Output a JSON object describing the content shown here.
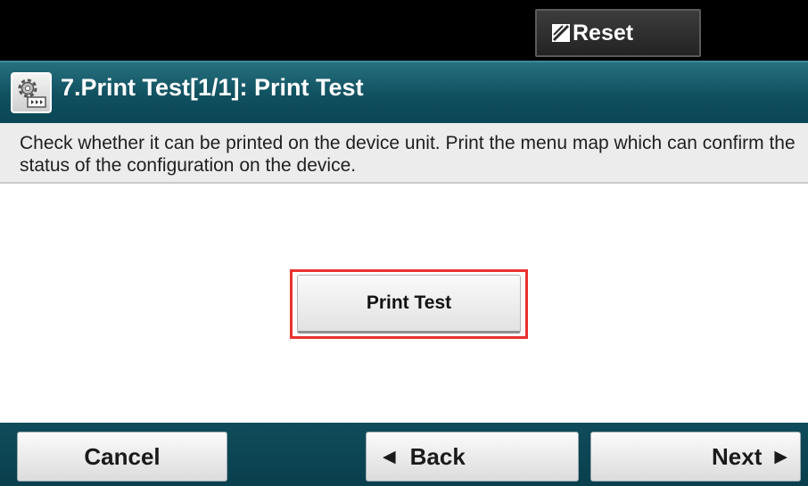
{
  "topbar": {
    "reset_label": "Reset",
    "reset_icon": "reset-slash-icon"
  },
  "titlebar": {
    "title": "7.Print Test[1/1]: Print Test",
    "icon": "settings-gear-icon"
  },
  "description": {
    "text": "Check whether it can be printed on the device unit. Print the menu map which can confirm the status of the configuration on the device."
  },
  "main": {
    "print_test_label": "Print Test"
  },
  "bottombar": {
    "cancel_label": "Cancel",
    "back_label": "Back",
    "next_label": "Next",
    "back_arrow": "◀",
    "next_arrow": "▶"
  },
  "colors": {
    "titlebar": "#10505f",
    "highlight": "#e8322f",
    "topbar": "#000000"
  }
}
